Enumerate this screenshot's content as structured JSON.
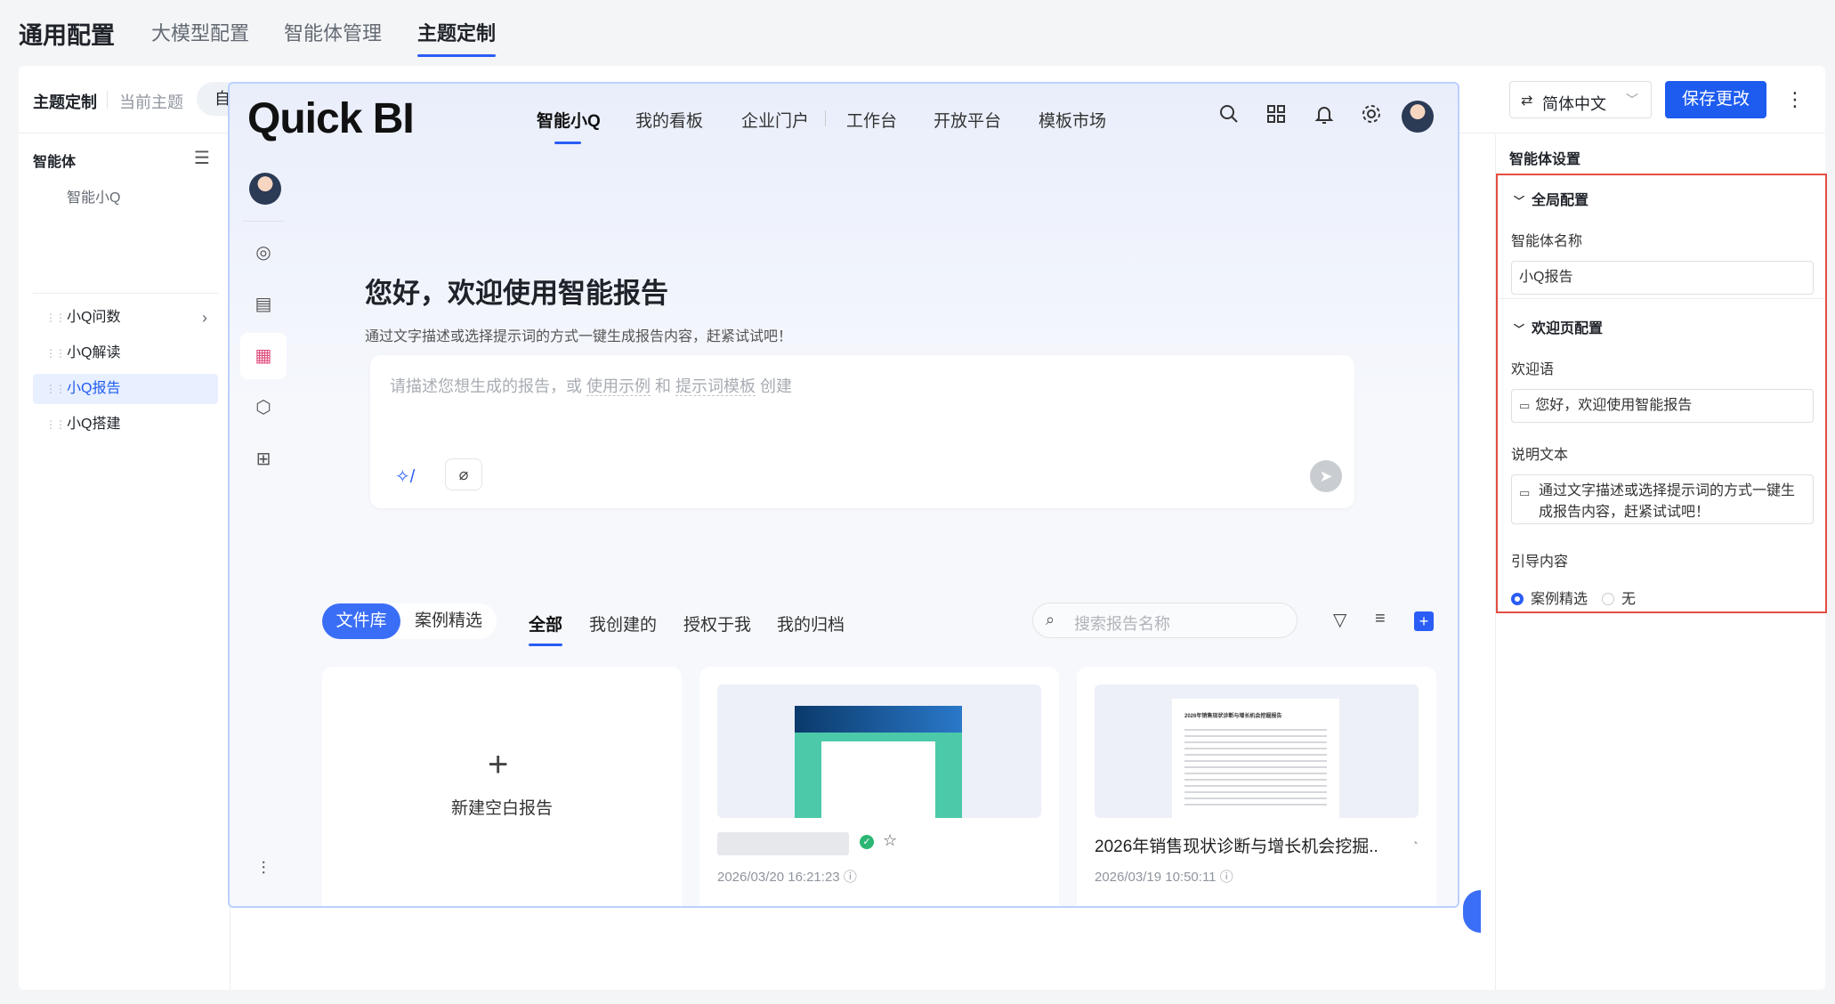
{
  "top_tabs": [
    {
      "label": "通用配置"
    },
    {
      "label": "大模型配置"
    },
    {
      "label": "智能体管理"
    },
    {
      "label": "主题定制"
    }
  ],
  "toolbar": {
    "title": "主题定制",
    "current_theme": "当前主题",
    "custom_theme": "自定义主题",
    "language": "简体中文",
    "save_label": "保存更改",
    "more": "⋮"
  },
  "left_panel": {
    "title": "智能体",
    "items": [
      {
        "label": "智能小Q"
      },
      {
        "label": "小Q问数"
      },
      {
        "label": "小Q解读"
      },
      {
        "label": "小Q报告"
      },
      {
        "label": "小Q搭建"
      }
    ]
  },
  "preview": {
    "logo": "Quick BI",
    "nav": [
      "智能小Q",
      "我的看板",
      "企业门户",
      "工作台",
      "开放平台",
      "模板市场"
    ],
    "welcome_title": "您好，欢迎使用智能报告",
    "welcome_desc": "通过文字描述或选择提示词的方式一键生成报告内容，赶紧试试吧！",
    "input": {
      "ph_1": "请描述您想生成的报告，或 ",
      "ph_link1": "使用示例",
      "ph_2": " 和 ",
      "ph_link2": "提示词模板",
      "ph_3": " 创建"
    },
    "segment": [
      "文件库",
      "案例精选"
    ],
    "filter_tabs": [
      "全部",
      "我创建的",
      "授权于我",
      "我的归档"
    ],
    "search_placeholder": "搜索报告名称",
    "cards": [
      {
        "label": "新建空白报告"
      },
      {
        "title": "",
        "date": "2026/03/20 16:21:23"
      },
      {
        "title": "2026年销售现状诊断与增长机会挖掘...",
        "date": "2026/03/19 10:50:11",
        "thumb_heading": "2026年销售现状诊断与增长机会挖掘报告"
      }
    ]
  },
  "right_panel": {
    "title": "智能体设置",
    "global_section": "全局配置",
    "name_label": "智能体名称",
    "name_value": "小Q报告",
    "welcome_section": "欢迎页配置",
    "greeting_label": "欢迎语",
    "greeting_value": "您好，欢迎使用智能报告",
    "desc_label": "说明文本",
    "desc_value": "通过文字描述或选择提示词的方式一键生成报告内容，赶紧试试吧！",
    "guide_label": "引导内容",
    "guide_options": [
      "案例精选",
      "无"
    ],
    "guide_selected": "案例精选"
  },
  "colors": {
    "accent": "#1e5cf0",
    "highlight_box": "#e54d42"
  }
}
